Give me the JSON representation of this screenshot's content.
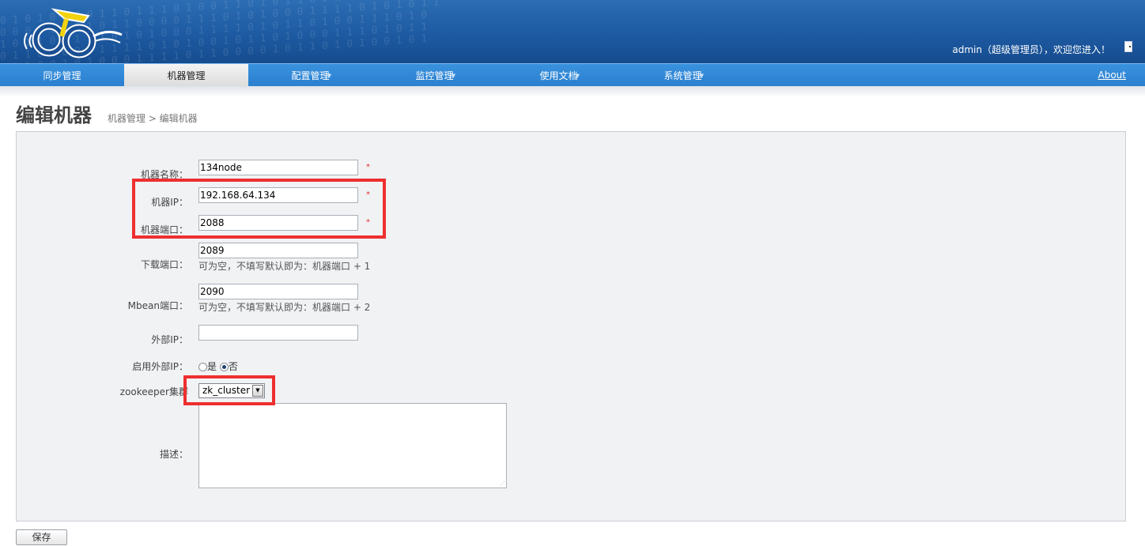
{
  "header": {
    "binary_pattern": [
      "0 1 0 1 0 1 0 0 1 1 0 1 1 1 0 1 0 0 1 1 0 1 0 1 1 0 0 1 0 1 1 1 0 1 0 0 1",
      "0 0 0 1 1 1 0 1 0 1 1 0 0 0 0 1 1 1 0 1 0 1 0 0 0 1 1 1 1 0 1 0 1 0 1 1",
      "1 0 1 1 0 0 1 1 1 0 1 0 1 0 0 0 1 1 1 1 0 1 0 1 1 0 1 0 0 1 1 1 0 1 0",
      "0 1 1 0 1 0 0 0 1 1 1 1 0 1 0 1 0 0 1 0 1 1 0 1 0 0 0 1 1 1 0 1 0 1 1",
      "1 1 1 0 0 1 0 1 0 0 0 1 1 1 1 0 1 1 0 0 0 0 1 0 1 1 0 1 0 1 0 0 1 0 1"
    ],
    "user_text": "admin（超级管理员），欢迎您进入！",
    "colors": {
      "header_bg": "#1d5aa2",
      "logo_yellow": "#f2d20c",
      "logo_blue": "#1a4f93",
      "nav_bg": "#2a7fcf",
      "highlight_red": "#ee2f2f",
      "required_red": "#e03030"
    }
  },
  "nav": {
    "items": [
      {
        "label": "同步管理",
        "has_dropdown": false,
        "active": false
      },
      {
        "label": "机器管理",
        "has_dropdown": false,
        "active": true
      },
      {
        "label": "配置管理",
        "has_dropdown": true,
        "active": false
      },
      {
        "label": "监控管理",
        "has_dropdown": true,
        "active": false
      },
      {
        "label": "使用文档",
        "has_dropdown": true,
        "active": false
      },
      {
        "label": "系统管理",
        "has_dropdown": true,
        "active": false
      }
    ],
    "dropdown_glyph": "▼",
    "about_label": "About"
  },
  "page": {
    "title": "编辑机器",
    "breadcrumb": "机器管理 > 编辑机器"
  },
  "form": {
    "machine_name": {
      "label": "机器名称：",
      "value": "134node",
      "required_mark": "*"
    },
    "machine_ip": {
      "label": "机器IP：",
      "value": "192.168.64.134",
      "required_mark": "*"
    },
    "machine_port": {
      "label": "机器端口：",
      "value": "2088",
      "required_mark": "*"
    },
    "download_port": {
      "label": "下载端口：",
      "value": "2089",
      "hint": "可为空，不填写默认即为：机器端口 + 1"
    },
    "mbean_port": {
      "label": "Mbean端口：",
      "value": "2090",
      "hint": "可为空，不填写默认即为：机器端口 + 2"
    },
    "external_ip": {
      "label": "外部IP：",
      "value": ""
    },
    "enable_external_ip": {
      "label": "启用外部IP：",
      "options": [
        "是",
        "否"
      ],
      "selected": "否"
    },
    "zookeeper_cluster": {
      "label": "zookeeper集群",
      "selected": "zk_cluster",
      "caret": "▼"
    },
    "description": {
      "label": "描述：",
      "value": ""
    }
  },
  "actions": {
    "save_label": "保存"
  }
}
